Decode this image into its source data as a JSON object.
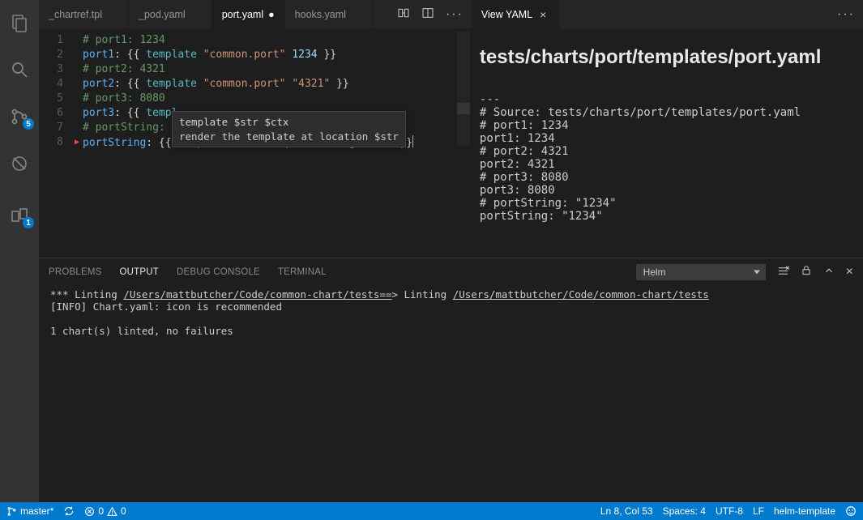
{
  "activity": {
    "scm_badge": "5",
    "diff_badge": "1"
  },
  "tabs_left": [
    {
      "label": "_chartref.tpl",
      "active": false,
      "dirty": false
    },
    {
      "label": "_pod.yaml",
      "active": false,
      "dirty": false
    },
    {
      "label": "port.yaml",
      "active": true,
      "dirty": true
    },
    {
      "label": "hooks.yaml",
      "active": false,
      "dirty": false
    }
  ],
  "tabs_right": [
    {
      "label": "View YAML",
      "active": true
    }
  ],
  "editor": {
    "lines": [
      "1",
      "2",
      "3",
      "4",
      "5",
      "6",
      "7",
      "8"
    ],
    "l1_comment": "# port1: 1234",
    "l2_key": "port1",
    "l2_rest": ": {{ template \"common.port\" 1234 }}",
    "l3_comment": "# port2: 4321",
    "l4_key": "port2",
    "l4_rest": ": {{ template \"common.port\" \"4321\" }}",
    "l5_comment": "# port3: 8080",
    "l6_key": "port3",
    "l6_rest": ": {{ templ",
    "l7_comment": "# portString: \"",
    "l8_key": "portString",
    "l8_rest": ": {{ template \"common.port.string\" 1234 }}"
  },
  "hover": {
    "signature": "template $str $ctx",
    "description": "render the template at location $str"
  },
  "preview": {
    "title": "tests/charts/port/templates/port.yaml",
    "body": "---\n# Source: tests/charts/port/templates/port.yaml\n# port1: 1234\nport1: 1234\n# port2: 4321\nport2: 4321\n# port3: 8080\nport3: 8080\n# portString: \"1234\"\nportString: \"1234\""
  },
  "panel": {
    "tabs": {
      "problems": "PROBLEMS",
      "output": "OUTPUT",
      "debug": "DEBUG CONSOLE",
      "terminal": "TERMINAL"
    },
    "select": "Helm",
    "line1a": "*** Linting ",
    "line1b": "/Users/mattbutcher/Code/common-chart/tests==",
    "line1c": "> Linting ",
    "line1d": "/Users/mattbutcher/Code/common-chart/tests",
    "line2": "[INFO] Chart.yaml: icon is recommended",
    "line3": "1 chart(s) linted, no failures"
  },
  "status": {
    "branch": "master*",
    "errors": "0",
    "warnings": "0",
    "pos": "Ln 8, Col 53",
    "spaces": "Spaces: 4",
    "encoding": "UTF-8",
    "eol": "LF",
    "mode": "helm-template"
  }
}
